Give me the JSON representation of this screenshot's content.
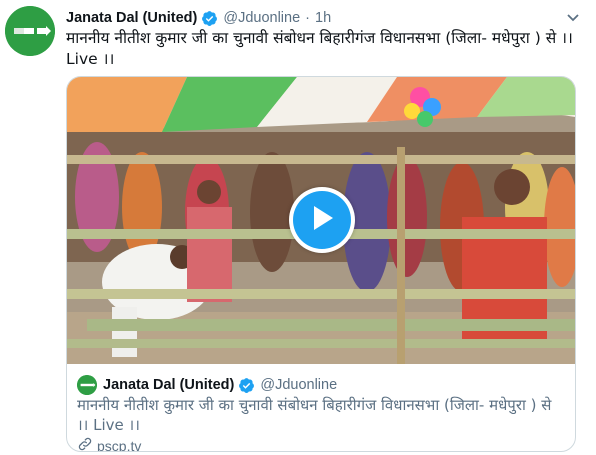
{
  "tweet": {
    "author_name": "Janata Dal (United)",
    "handle": "@Jduonline",
    "separator": "·",
    "time": "1h",
    "text": "माननीय नीतीश कुमार जी का चुनावी संबोधन बिहारीगंज विधानसभा (जिला- मधेपुरा ) से ।। Live ।।",
    "verified_icon": "verified-badge-icon",
    "more_icon": "chevron-down-icon"
  },
  "card": {
    "media_type": "video",
    "play_icon": "play-icon",
    "quoted_author_name": "Janata Dal (United)",
    "quoted_handle": "@Jduonline",
    "quoted_text": "माननीय नीतीश कुमार जी का चुनावी संबोधन बिहारीगंज विधानसभा (जिला- मधेपुरा ) से ।। Live ।।",
    "link_icon": "link-icon",
    "link_domain": "pscp.tv"
  },
  "colors": {
    "accent": "#1da1f2",
    "brand_green": "#2e9e44",
    "secondary_text": "#5b7083",
    "border": "#cfd9de"
  }
}
